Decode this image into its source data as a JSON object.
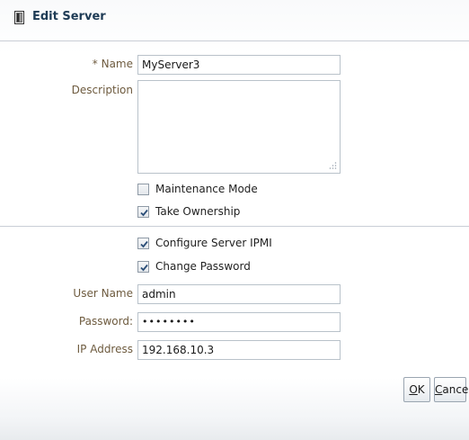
{
  "dialog": {
    "title": "Edit Server"
  },
  "form": {
    "name": {
      "required_mark": "*",
      "label": "Name",
      "value": "MyServer3"
    },
    "description": {
      "label": "Description",
      "value": ""
    },
    "maintenance_mode": {
      "label": "Maintenance Mode",
      "checked": false
    },
    "take_ownership": {
      "label": "Take Ownership",
      "checked": true
    },
    "configure_ipmi": {
      "label": "Configure Server IPMI",
      "checked": true
    },
    "change_password": {
      "label": "Change Password",
      "checked": true
    },
    "user_name": {
      "label": "User Name",
      "value": "admin"
    },
    "password": {
      "label": "Password:",
      "value": "••••••••"
    },
    "ip_address": {
      "label": "IP Address",
      "value": "192.168.10.3"
    }
  },
  "buttons": {
    "ok": {
      "mnemonic": "O",
      "rest": "K"
    },
    "cancel": {
      "mnemonic": "C",
      "rest": "ancel"
    }
  },
  "colors": {
    "label": "#6e5b3f",
    "title": "#1e3b55",
    "border": "#b9c2ca"
  },
  "icons": {
    "title": "server-icon",
    "checkbox_check": "checkmark-icon",
    "resize": "resize-grip-icon"
  }
}
